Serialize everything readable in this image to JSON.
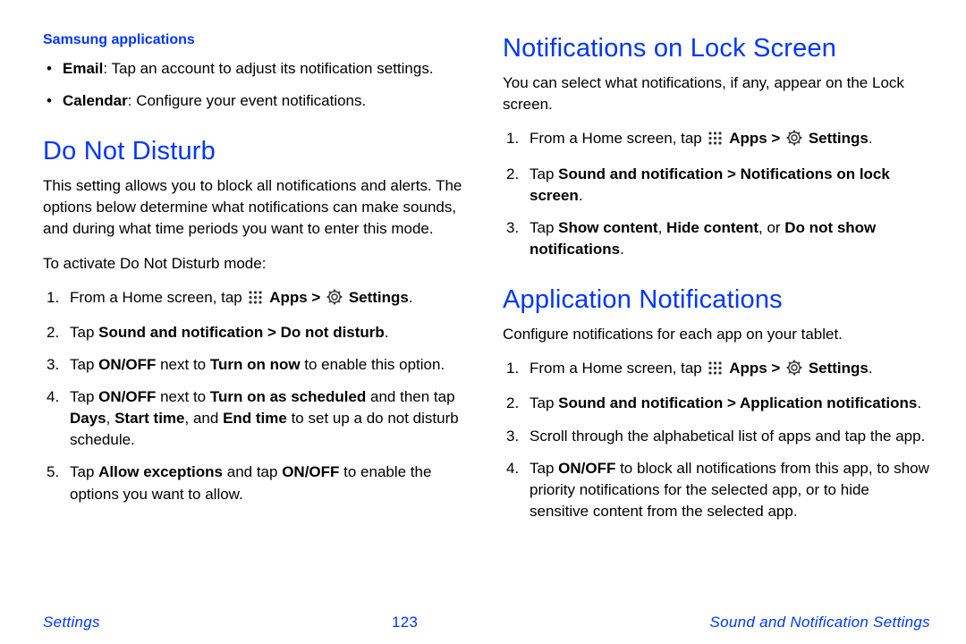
{
  "left": {
    "subhead": "Samsung applications",
    "bullets": [
      {
        "strong": "Email",
        "rest": ": Tap an account to adjust its notification settings."
      },
      {
        "strong": "Calendar",
        "rest": ": Configure your event notifications."
      }
    ],
    "h2": "Do Not Disturb",
    "intro": "This setting allows you to block all notifications and alerts. The options below determine what notifications can make sounds, and during what time periods you want to enter this mode.",
    "leadin": "To activate Do Not Disturb mode:",
    "steps": {
      "s1_pre": "From a Home screen, tap ",
      "s1_apps": "Apps > ",
      "s1_settings": "Settings",
      "s1_post": ".",
      "s2_pre": "Tap ",
      "s2_bold": "Sound and notification > Do not disturb",
      "s2_post": ".",
      "s3_a": "Tap ",
      "s3_b": "ON/OFF",
      "s3_c": " next to ",
      "s3_d": "Turn on now",
      "s3_e": " to enable this option.",
      "s4_a": "Tap ",
      "s4_b": "ON/OFF",
      "s4_c": " next to ",
      "s4_d": "Turn on as scheduled",
      "s4_e": " and then tap ",
      "s4_f": "Days",
      "s4_g": ", ",
      "s4_h": "Start time",
      "s4_i": ", and ",
      "s4_j": "End time",
      "s4_k": " to set up a do not disturb schedule.",
      "s5_a": "Tap ",
      "s5_b": "Allow exceptions",
      "s5_c": " and tap ",
      "s5_d": "ON/OFF",
      "s5_e": " to enable the options you want to allow."
    }
  },
  "right": {
    "h2a": "Notifications on Lock Screen",
    "introa": "You can select what notifications, if any, appear on the Lock screen.",
    "stepsa": {
      "s1_pre": "From a Home screen, tap ",
      "s1_apps": "Apps > ",
      "s1_settings": "Settings",
      "s1_post": ".",
      "s2_pre": "Tap ",
      "s2_bold": "Sound and notification > Notifications on lock screen",
      "s2_post": ".",
      "s3_a": "Tap ",
      "s3_b": "Show content",
      "s3_c": ", ",
      "s3_d": "Hide content",
      "s3_e": ", or ",
      "s3_f": "Do not show notifications",
      "s3_g": "."
    },
    "h2b": "Application Notifications",
    "introb": "Configure notifications for each app on your tablet.",
    "stepsb": {
      "s1_pre": "From a Home screen, tap ",
      "s1_apps": "Apps > ",
      "s1_settings": "Settings",
      "s1_post": ".",
      "s2_pre": "Tap ",
      "s2_bold": "Sound and notification > Application notifications",
      "s2_post": ".",
      "s3": "Scroll through the alphabetical list of apps and tap the app.",
      "s4_a": "Tap ",
      "s4_b": "ON/OFF",
      "s4_c": " to block all notifications from this app, to show priority notifications for the selected app, or to hide sensitive content from the selected app."
    }
  },
  "footer": {
    "left": "Settings",
    "center": "123",
    "right": "Sound and Notification Settings"
  }
}
